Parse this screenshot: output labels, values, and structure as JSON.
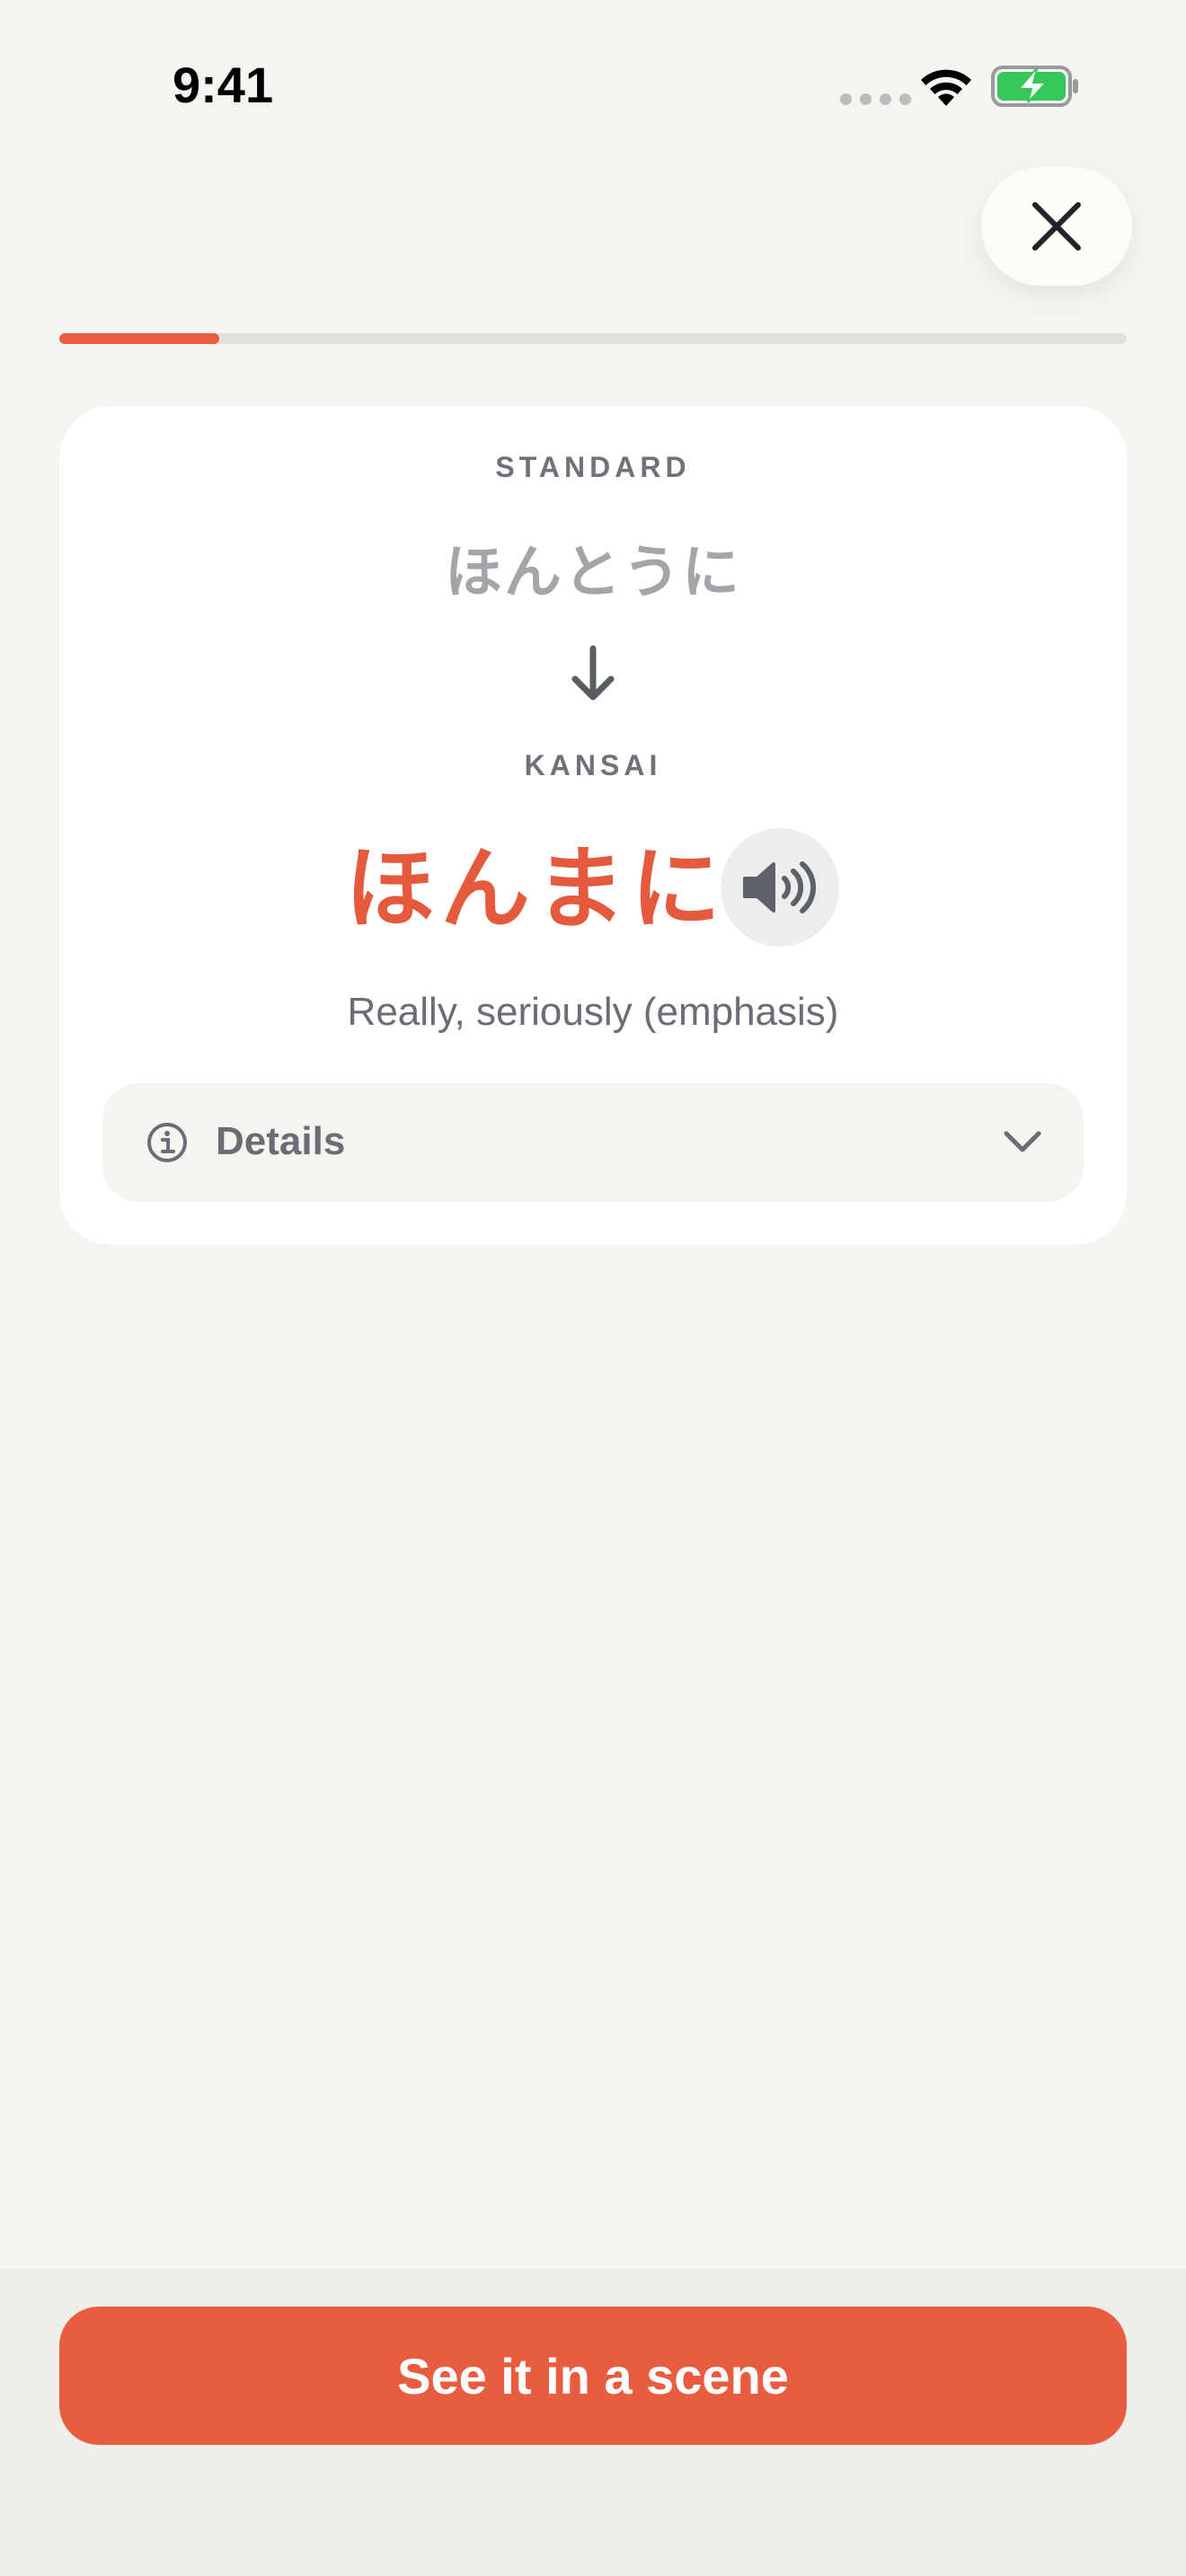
{
  "status_bar": {
    "time": "9:41"
  },
  "close_button": {
    "icon": "close-icon"
  },
  "progress": {
    "fraction": 0.15,
    "color": "#e85c3f"
  },
  "card": {
    "standard_label": "STANDARD",
    "standard_word": "ほんとうに",
    "kansai_label": "KANSAI",
    "kansai_word": "ほんまに",
    "meaning": "Really, seriously (emphasis)",
    "details_label": "Details"
  },
  "cta": {
    "label": "See it in a scene"
  },
  "colors": {
    "accent": "#e85c3f",
    "background": "#f5f4f1",
    "card": "#ffffff",
    "battery_green": "#34c759"
  }
}
